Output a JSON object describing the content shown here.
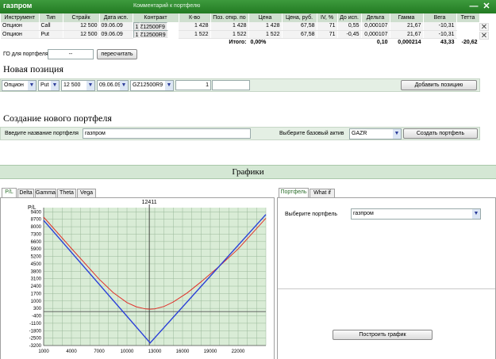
{
  "header": {
    "title": "газпром",
    "comment": "Комментарий к портфелю",
    "minimize": "—",
    "close": "✕"
  },
  "table": {
    "columns": [
      "Инструмент",
      "Тип",
      "Страйк",
      "Дата исп.",
      "Контракт",
      "К-во",
      "Поз. откр. по",
      "Цена",
      "Цена, руб.",
      "IV, %",
      "До исп.",
      "Дельта",
      "Гамма",
      "Вега",
      "Тетта"
    ],
    "rows": [
      [
        "Опцион",
        "Call",
        "12 500",
        "09.06.09",
        "GZ12500F9",
        "1",
        "1 428",
        "1 428",
        "1 428",
        "67,58",
        "71",
        "0,55",
        "0,000107",
        "21,67",
        "-10,31"
      ],
      [
        "Опцион",
        "Put",
        "12 500",
        "09.06.09",
        "GZ12500R9",
        "1",
        "1 522",
        "1 522",
        "1 522",
        "67,58",
        "71",
        "-0,45",
        "0,000107",
        "21,67",
        "-10,31"
      ]
    ],
    "totals": {
      "label": "Итого:",
      "price_pct": "0,00%",
      "delta": "0,10",
      "gamma": "0,000214",
      "vega": "43,33",
      "theta": "-20,62"
    }
  },
  "go": {
    "label": "ГО для портфеля:",
    "value": "--",
    "button": "пересчитать"
  },
  "new_position": {
    "title": "Новая позиция",
    "instrument": "Опцион",
    "type": "Put",
    "strike": "12 500",
    "date": "09.06.09",
    "contract": "GZ12500R9",
    "qty": "1",
    "price": "",
    "button": "Добавить позицию"
  },
  "create": {
    "title": "Создание нового портфеля",
    "name_label": "Введите название портфеля",
    "name_value": "газпром",
    "asset_label": "Выберите базовый актив",
    "asset_value": "GAZR",
    "button": "Создать портфель"
  },
  "charts": {
    "title": "Графики",
    "tabs": [
      "P/L",
      "Delta",
      "Gamma",
      "Theta",
      "Vega"
    ],
    "right_tabs": [
      "Портфель",
      "What if"
    ],
    "portfolio_label": "Выберите портфель",
    "portfolio_value": "газпром",
    "build_button": "Построить график"
  },
  "chart_data": {
    "type": "line",
    "ylabel": "P/L",
    "marker": {
      "x": 12411,
      "label": "12411"
    },
    "xticks": [
      1000,
      4000,
      7000,
      10000,
      13000,
      16000,
      19000,
      22000
    ],
    "yticks": [
      9400,
      8700,
      8000,
      7300,
      6600,
      5900,
      5200,
      4500,
      3800,
      3100,
      2400,
      1700,
      1000,
      300,
      -400,
      -1100,
      -1800,
      -2500,
      -3200
    ],
    "xlim": [
      1000,
      25000
    ],
    "ylim": [
      -3200,
      9800
    ],
    "series": [
      {
        "color": "#e0302a",
        "x": [
          1000,
          4000,
          7000,
          8500,
          10000,
          11000,
          12000,
          12500,
          13000,
          14000,
          15000,
          16500,
          18000,
          20000,
          22000,
          25000
        ],
        "y": [
          8900,
          5950,
          3050,
          1800,
          850,
          450,
          250,
          230,
          260,
          480,
          900,
          1750,
          2800,
          4300,
          5900,
          8800
        ]
      },
      {
        "color": "#2a3fd8",
        "x": [
          1000,
          12500,
          25000
        ],
        "y": [
          8600,
          -2950,
          9150
        ]
      }
    ],
    "grid": true
  }
}
